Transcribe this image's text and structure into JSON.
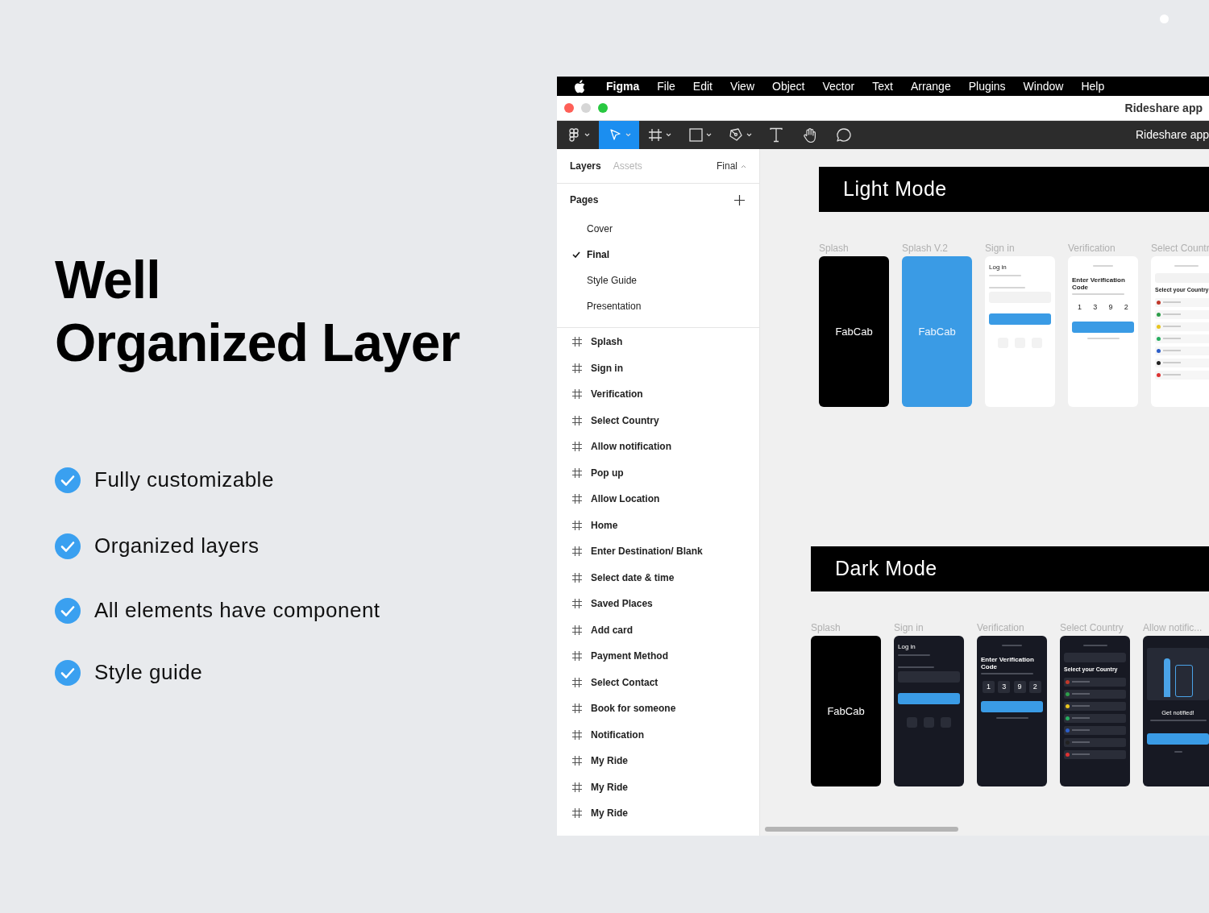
{
  "headline": [
    "Well",
    "Organized Layer"
  ],
  "features": [
    "Fully customizable",
    "Organized layers",
    "All elements have component",
    "Style guide"
  ],
  "menu_bar": {
    "app_name": "Figma",
    "menus": [
      "File",
      "Edit",
      "View",
      "Object",
      "Vector",
      "Text",
      "Arrange",
      "Plugins",
      "Window",
      "Help"
    ]
  },
  "window": {
    "title": "Rideshare app"
  },
  "toolbar": {
    "tools": [
      {
        "kind": "logo",
        "selected": false,
        "caret": true
      },
      {
        "kind": "move",
        "selected": true,
        "caret": true
      },
      {
        "kind": "frame",
        "selected": false,
        "caret": true
      },
      {
        "kind": "shape",
        "selected": false,
        "caret": true
      },
      {
        "kind": "pen",
        "selected": false,
        "caret": true
      },
      {
        "kind": "text",
        "selected": false,
        "caret": false
      },
      {
        "kind": "hand",
        "selected": false,
        "caret": false
      },
      {
        "kind": "comment",
        "selected": false,
        "caret": false
      }
    ],
    "file_name": "Rideshare app"
  },
  "sidebar": {
    "tabs": [
      {
        "label": "Layers",
        "selected": true
      },
      {
        "label": "Assets",
        "selected": false
      }
    ],
    "page_menu": "Final",
    "pages_heading": "Pages",
    "pages": [
      {
        "label": "Cover",
        "selected": false
      },
      {
        "label": "Final",
        "selected": true
      },
      {
        "label": "Style Guide",
        "selected": false
      },
      {
        "label": "Presentation",
        "selected": false
      }
    ],
    "layers": [
      "Splash",
      "Sign in",
      "Verification",
      "Select Country",
      "Allow notification",
      "Pop up",
      "Allow Location",
      "Home",
      "Enter Destination/ Blank",
      "Select date & time",
      "Saved Places",
      "Add card",
      "Payment Method",
      "Select Contact",
      "Book for someone",
      "Notification",
      "My Ride",
      "My Ride",
      "My Ride"
    ]
  },
  "canvas": {
    "sections": [
      {
        "title": "Light Mode",
        "kind": "light",
        "frames": [
          {
            "label": "Splash",
            "kind": "splash",
            "brand": "FabCab"
          },
          {
            "label": "Splash V.2",
            "kind": "splash_blue",
            "brand": "FabCab"
          },
          {
            "label": "Sign in",
            "kind": "signin",
            "heading": "Log in"
          },
          {
            "label": "Verification",
            "kind": "verification",
            "heading": "Enter Verification Code",
            "digits": [
              "1",
              "3",
              "9",
              "2"
            ]
          },
          {
            "label": "Select Countr",
            "kind": "country",
            "heading": "Select your Country"
          }
        ]
      },
      {
        "title": "Dark Mode",
        "kind": "dark",
        "frames": [
          {
            "label": "Splash",
            "kind": "splash",
            "brand": "FabCab"
          },
          {
            "label": "Sign in",
            "kind": "signin",
            "heading": "Log in"
          },
          {
            "label": "Verification",
            "kind": "verification",
            "heading": "Enter Verification Code",
            "digits": [
              "1",
              "3",
              "9",
              "2"
            ]
          },
          {
            "label": "Select Country",
            "kind": "country",
            "heading": "Select your Country"
          },
          {
            "label": "Allow notific...",
            "kind": "notify",
            "heading": "Get notified!"
          }
        ]
      }
    ]
  }
}
